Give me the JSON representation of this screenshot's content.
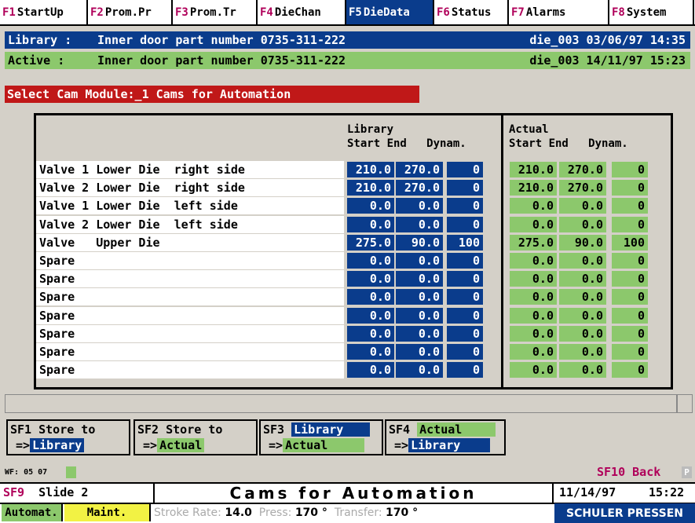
{
  "fkeys": [
    {
      "n": "F1",
      "label": "StartUp",
      "active": false
    },
    {
      "n": "F2",
      "label": "Prom.Pr",
      "active": false
    },
    {
      "n": "F3",
      "label": "Prom.Tr",
      "active": false
    },
    {
      "n": "F4",
      "label": "DieChan",
      "active": false
    },
    {
      "n": "F5",
      "label": "DieData",
      "active": true
    },
    {
      "n": "F6",
      "label": "Status",
      "active": false
    },
    {
      "n": "F7",
      "label": "Alarms",
      "active": false
    },
    {
      "n": "F8",
      "label": "System",
      "active": false
    }
  ],
  "library": {
    "label": "Library :",
    "text": "Inner door part number 0735-311-222",
    "date": "die_003 03/06/97 14:35"
  },
  "active": {
    "label": "Active  :",
    "text": "Inner door part number 0735-311-222",
    "date": "die_003 14/11/97 15:23"
  },
  "select_module": "Select Cam Module:_1 Cams for Automation",
  "headers": {
    "library_title": "Library",
    "library_cols": "Start End   Dynam.",
    "actual_title": "Actual",
    "actual_cols": "Start End   Dynam."
  },
  "rows": [
    {
      "label": "Valve 1 Lower Die  right side",
      "lib": [
        "210.0",
        "270.0",
        "0"
      ],
      "act": [
        "210.0",
        "270.0",
        "0"
      ]
    },
    {
      "label": "Valve 2 Lower Die  right side",
      "lib": [
        "210.0",
        "270.0",
        "0"
      ],
      "act": [
        "210.0",
        "270.0",
        "0"
      ]
    },
    {
      "label": "Valve 1 Lower Die  left side",
      "lib": [
        "0.0",
        "0.0",
        "0"
      ],
      "act": [
        "0.0",
        "0.0",
        "0"
      ]
    },
    {
      "label": "Valve 2 Lower Die  left side",
      "lib": [
        "0.0",
        "0.0",
        "0"
      ],
      "act": [
        "0.0",
        "0.0",
        "0"
      ]
    },
    {
      "label": "Valve   Upper Die",
      "lib": [
        "275.0",
        "90.0",
        "100"
      ],
      "act": [
        "275.0",
        "90.0",
        "100"
      ]
    },
    {
      "label": "Spare",
      "lib": [
        "0.0",
        "0.0",
        "0"
      ],
      "act": [
        "0.0",
        "0.0",
        "0"
      ]
    },
    {
      "label": "Spare",
      "lib": [
        "0.0",
        "0.0",
        "0"
      ],
      "act": [
        "0.0",
        "0.0",
        "0"
      ]
    },
    {
      "label": "Spare",
      "lib": [
        "0.0",
        "0.0",
        "0"
      ],
      "act": [
        "0.0",
        "0.0",
        "0"
      ]
    },
    {
      "label": "Spare",
      "lib": [
        "0.0",
        "0.0",
        "0"
      ],
      "act": [
        "0.0",
        "0.0",
        "0"
      ]
    },
    {
      "label": "Spare",
      "lib": [
        "0.0",
        "0.0",
        "0"
      ],
      "act": [
        "0.0",
        "0.0",
        "0"
      ]
    },
    {
      "label": "Spare",
      "lib": [
        "0.0",
        "0.0",
        "0"
      ],
      "act": [
        "0.0",
        "0.0",
        "0"
      ]
    },
    {
      "label": "Spare",
      "lib": [
        "0.0",
        "0.0",
        "0"
      ],
      "act": [
        "0.0",
        "0.0",
        "0"
      ]
    }
  ],
  "softkeys": {
    "sf1": {
      "line1": "SF1 Store to",
      "arrow": "=>",
      "target": "Library"
    },
    "sf2": {
      "line1": "SF2 Store to",
      "arrow": "=>",
      "target": "Actual"
    },
    "sf3": {
      "prefix": "SF3",
      "source": "Library",
      "arrow": "=>",
      "target": "Actual"
    },
    "sf4": {
      "prefix": "SF4",
      "source": "Actual",
      "arrow": "=>",
      "target": "Library"
    }
  },
  "wf": "WF: 05 07",
  "sf10": "SF10 Back",
  "pbox": "P",
  "sf9": {
    "n": "SF9",
    "label": "Slide 2"
  },
  "title": "Cams for Automation",
  "date": "11/14/97",
  "time": "15:22",
  "modes": {
    "automat": "Automat.",
    "maint": "Maint."
  },
  "status": {
    "stroke_label": "Stroke Rate:",
    "stroke_value": "14.0",
    "press_label": "Press:",
    "press_value": "170 °",
    "transfer_label": "Transfer:",
    "transfer_value": "170 °"
  },
  "brand": "SCHULER PRESSEN",
  "colors": {
    "blue": "#0a3c8c",
    "green": "#8cc86c",
    "red": "#c01818",
    "yellow": "#f2f244",
    "magenta": "#b0005a"
  }
}
